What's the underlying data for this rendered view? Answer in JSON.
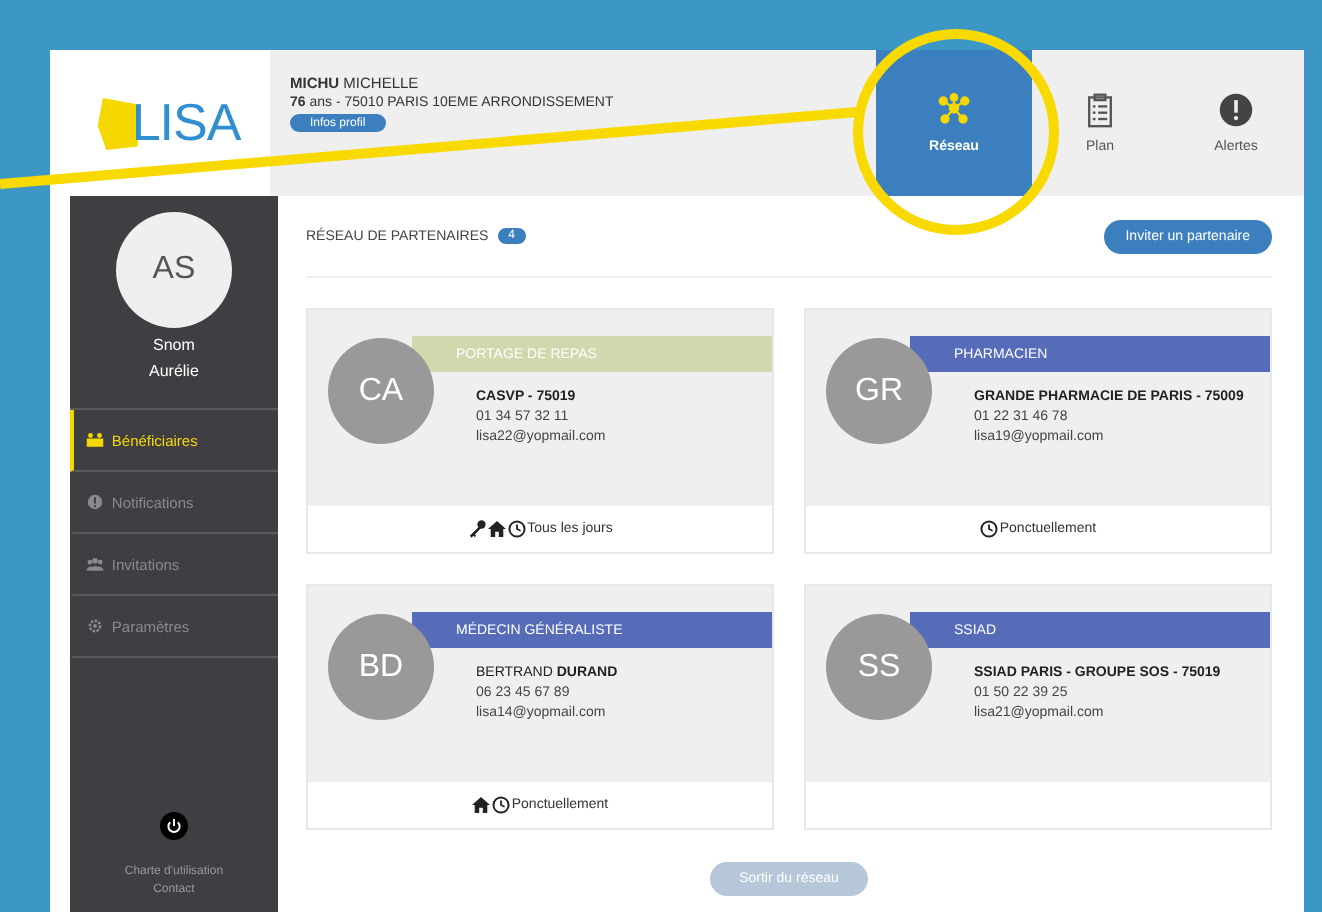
{
  "logo": {
    "text": "LISA"
  },
  "patient": {
    "last_name": "MICHU",
    "first_name": "MICHELLE",
    "details": "**76** ans - 75010 PARIS 10EME ARRONDISSEMENT",
    "profile_button": "Infos profil"
  },
  "nav_tabs": [
    {
      "label": "Réseau",
      "selected": true
    },
    {
      "label": "Plan",
      "selected": false
    },
    {
      "label": "Alertes",
      "selected": false
    }
  ],
  "user": {
    "initials": "AS",
    "last_name": "Snom",
    "first_name": "Aurélie"
  },
  "sidebar": {
    "items": [
      {
        "label": "Bénéficiaires",
        "selected": true
      },
      {
        "label": "Notifications",
        "selected": false
      },
      {
        "label": "Invitations",
        "selected": false
      },
      {
        "label": "Paramètres",
        "selected": false
      }
    ],
    "footer_links": [
      "Charte d'utilisation",
      "Contact"
    ]
  },
  "network": {
    "title": "RÉSEAU DE PARTENAIRES",
    "count": "4",
    "invite_button": "Inviter un partenaire"
  },
  "partners": [
    {
      "initials": "CA",
      "role": "PORTAGE DE REPAS",
      "color": "#d0d8ae",
      "kind": "organization",
      "name": "CASVP - 75019",
      "phone": "01 34 57 32 11",
      "email": "lisa22@yopmail.com",
      "keys": true,
      "home": true,
      "frequency": "Tous les jours"
    },
    {
      "initials": "GR",
      "role": "PHARMACIEN",
      "color": "#566cb8",
      "kind": "organization",
      "name": "GRANDE PHARMACIE DE PARIS - 75009",
      "phone": "01 22 31 46 78",
      "email": "lisa19@yopmail.com",
      "keys": false,
      "home": false,
      "frequency": "Ponctuellement"
    },
    {
      "initials": "BD",
      "role": "MÉDECIN GÉNÉRALISTE",
      "color": "#566cb8",
      "kind": "person",
      "first_name": "BERTRAND",
      "last_name": "DURAND",
      "phone": "06 23 45 67 89",
      "email": "lisa14@yopmail.com",
      "keys": false,
      "home": true,
      "frequency": "Ponctuellement"
    },
    {
      "initials": "SS",
      "role": "SSIAD",
      "color": "#566cb8",
      "kind": "organization",
      "name": "SSIAD PARIS - GROUPE SOS - 75019",
      "phone": "01 50 22 39 25",
      "email": "lisa21@yopmail.com",
      "keys": false,
      "home": false
    }
  ],
  "exit_button": "Sortir du réseau"
}
